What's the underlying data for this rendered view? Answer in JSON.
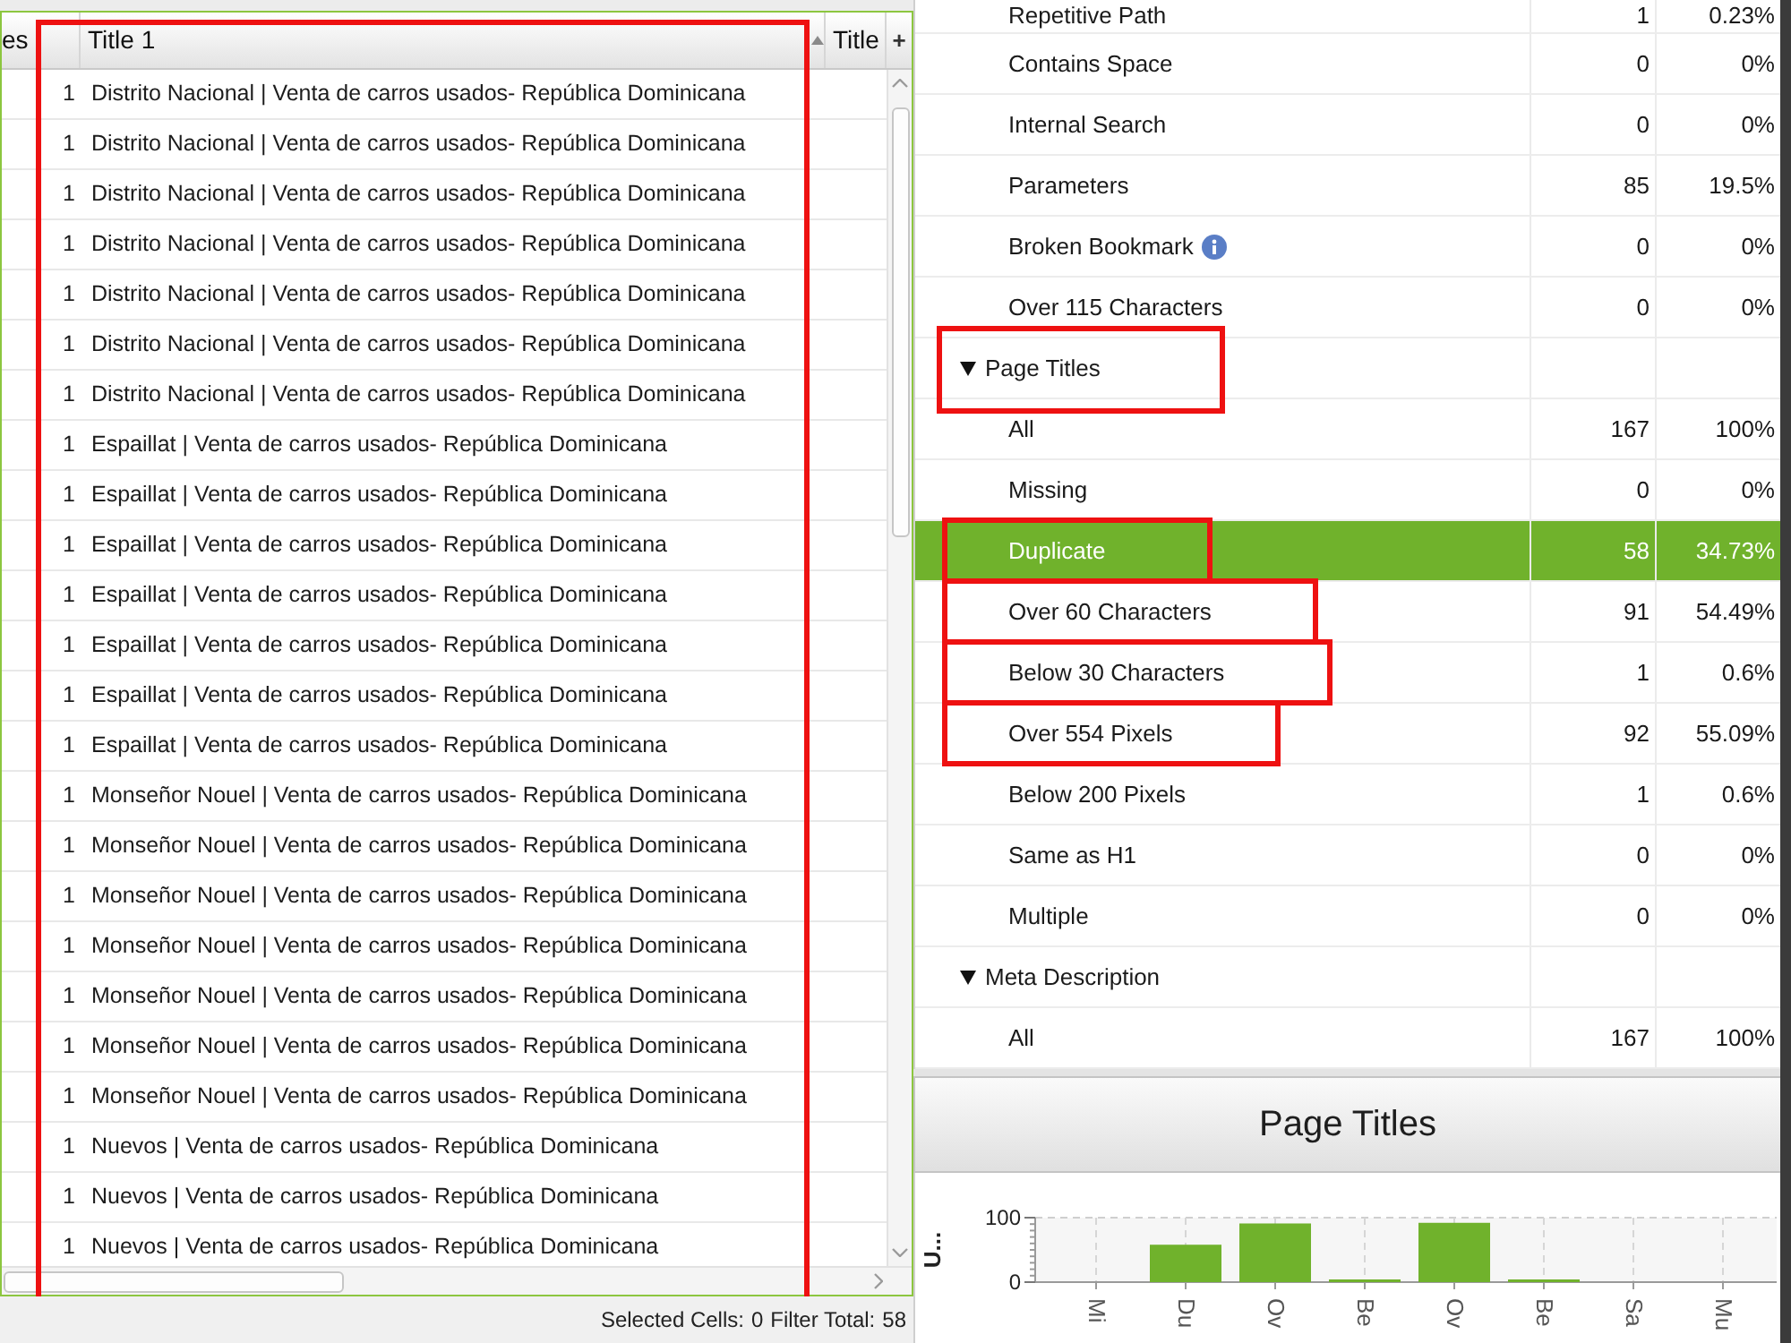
{
  "results_table": {
    "columns": [
      {
        "label": "es",
        "sorted": false,
        "highlighted": false
      },
      {
        "label": "Title 1",
        "sorted": true,
        "highlighted": true
      },
      {
        "label": "Title",
        "sorted": false,
        "highlighted": false
      }
    ],
    "column_chooser": "+",
    "rows": [
      [
        "1",
        "Distrito Nacional | Venta de carros usados- República Dominicana"
      ],
      [
        "1",
        "Distrito Nacional | Venta de carros usados- República Dominicana"
      ],
      [
        "1",
        "Distrito Nacional | Venta de carros usados- República Dominicana"
      ],
      [
        "1",
        "Distrito Nacional | Venta de carros usados- República Dominicana"
      ],
      [
        "1",
        "Distrito Nacional | Venta de carros usados- República Dominicana"
      ],
      [
        "1",
        "Distrito Nacional | Venta de carros usados- República Dominicana"
      ],
      [
        "1",
        "Distrito Nacional | Venta de carros usados- República Dominicana"
      ],
      [
        "1",
        "Espaillat | Venta de carros usados- República Dominicana"
      ],
      [
        "1",
        "Espaillat | Venta de carros usados- República Dominicana"
      ],
      [
        "1",
        "Espaillat | Venta de carros usados- República Dominicana"
      ],
      [
        "1",
        "Espaillat | Venta de carros usados- República Dominicana"
      ],
      [
        "1",
        "Espaillat | Venta de carros usados- República Dominicana"
      ],
      [
        "1",
        "Espaillat | Venta de carros usados- República Dominicana"
      ],
      [
        "1",
        "Espaillat | Venta de carros usados- República Dominicana"
      ],
      [
        "1",
        "Monseñor Nouel | Venta de carros usados- República Dominicana"
      ],
      [
        "1",
        "Monseñor Nouel | Venta de carros usados- República Dominicana"
      ],
      [
        "1",
        "Monseñor Nouel | Venta de carros usados- República Dominicana"
      ],
      [
        "1",
        "Monseñor Nouel | Venta de carros usados- República Dominicana"
      ],
      [
        "1",
        "Monseñor Nouel | Venta de carros usados- República Dominicana"
      ],
      [
        "1",
        "Monseñor Nouel | Venta de carros usados- República Dominicana"
      ],
      [
        "1",
        "Monseñor Nouel | Venta de carros usados- República Dominicana"
      ],
      [
        "1",
        "Nuevos | Venta de carros usados- República Dominicana"
      ],
      [
        "1",
        "Nuevos | Venta de carros usados- República Dominicana"
      ],
      [
        "1",
        "Nuevos | Venta de carros usados- República Dominicana"
      ]
    ]
  },
  "status_bar": [
    {
      "label": "Selected Cells:",
      "value": "0"
    },
    {
      "label": "Filter Total:",
      "value": "58"
    }
  ],
  "overview": [
    {
      "children": [
        {
          "label": "Repetitive Path",
          "count": "1",
          "percent": "0.23%",
          "info": false,
          "selected": false,
          "highlighted": false
        },
        {
          "label": "Contains Space",
          "count": "0",
          "percent": "0%",
          "info": false,
          "selected": false,
          "highlighted": false
        },
        {
          "label": "Internal Search",
          "count": "0",
          "percent": "0%",
          "info": false,
          "selected": false,
          "highlighted": false
        },
        {
          "label": "Parameters",
          "count": "85",
          "percent": "19.5%",
          "info": false,
          "selected": false,
          "highlighted": false
        },
        {
          "label": "Broken Bookmark",
          "count": "0",
          "percent": "0%",
          "info": true,
          "selected": false,
          "highlighted": false
        },
        {
          "label": "Over 115 Characters",
          "count": "0",
          "percent": "0%",
          "info": false,
          "selected": false,
          "highlighted": false
        }
      ]
    },
    {
      "label": "Page Titles",
      "expanded": true,
      "highlighted": true,
      "children": [
        {
          "label": "All",
          "count": "167",
          "percent": "100%",
          "info": false,
          "selected": false,
          "highlighted": false
        },
        {
          "label": "Missing",
          "count": "0",
          "percent": "0%",
          "info": false,
          "selected": false,
          "highlighted": false
        },
        {
          "label": "Duplicate",
          "count": "58",
          "percent": "34.73%",
          "info": false,
          "selected": true,
          "highlighted": true
        },
        {
          "label": "Over 60 Characters",
          "count": "91",
          "percent": "54.49%",
          "info": false,
          "selected": false,
          "highlighted": true
        },
        {
          "label": "Below 30 Characters",
          "count": "1",
          "percent": "0.6%",
          "info": false,
          "selected": false,
          "highlighted": true
        },
        {
          "label": "Over 554 Pixels",
          "count": "92",
          "percent": "55.09%",
          "info": false,
          "selected": false,
          "highlighted": true
        },
        {
          "label": "Below 200 Pixels",
          "count": "1",
          "percent": "0.6%",
          "info": false,
          "selected": false,
          "highlighted": false
        },
        {
          "label": "Same as H1",
          "count": "0",
          "percent": "0%",
          "info": false,
          "selected": false,
          "highlighted": false
        },
        {
          "label": "Multiple",
          "count": "0",
          "percent": "0%",
          "info": false,
          "selected": false,
          "highlighted": false
        }
      ]
    },
    {
      "label": "Meta Description",
      "expanded": true,
      "highlighted": false,
      "children": [
        {
          "label": "All",
          "count": "167",
          "percent": "100%",
          "info": false,
          "selected": false,
          "highlighted": false
        }
      ]
    }
  ],
  "chart_panel": {
    "title": "Page Titles",
    "chart_data": [
      {
        "type": "bar",
        "ylabel": "U...",
        "categories": [
          "Mi",
          "Du",
          "Ov",
          "Be",
          "Ov",
          "Be",
          "Sa",
          "Mu"
        ],
        "values": [
          0,
          58,
          91,
          1,
          92,
          1,
          0,
          0
        ],
        "color": "#70b22c",
        "yticks": [
          0,
          100
        ],
        "ylim": [
          0,
          100
        ],
        "grid": true
      }
    ]
  }
}
